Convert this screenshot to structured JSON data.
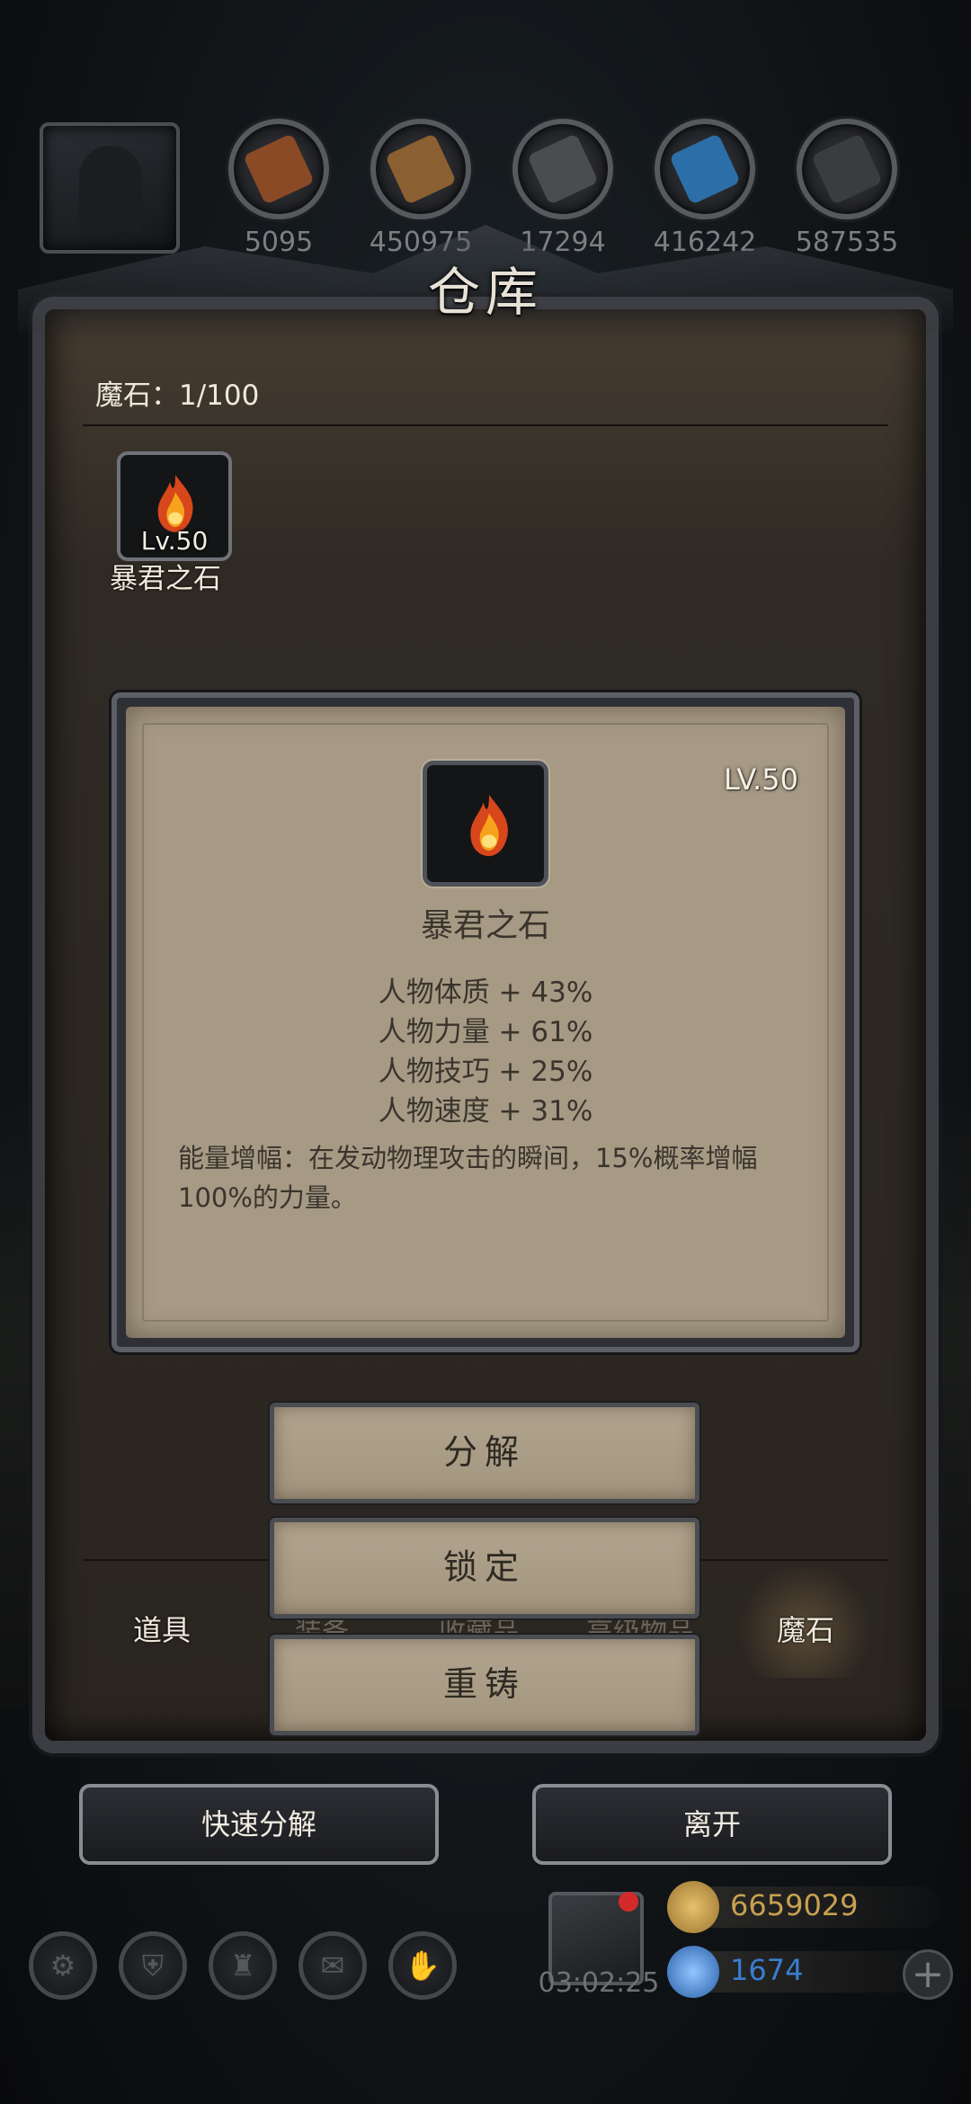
{
  "top_resources": {
    "values": [
      "5095",
      "450975",
      "17294",
      "416242",
      "587535"
    ],
    "colors": [
      "#8a4a26",
      "#8a6032",
      "#4a4c50",
      "#2c6fa8",
      "#3a3c40"
    ]
  },
  "panel": {
    "title": "仓库",
    "count_label": "魔石：1/100"
  },
  "slot": {
    "level": "Lv.50",
    "name": "暴君之石",
    "icon": "fire-stone-icon"
  },
  "detail": {
    "level": "LV.50",
    "name": "暴君之石",
    "stats": [
      "人物体质 + 43%",
      "人物力量 + 61%",
      "人物技巧 + 25%",
      "人物速度 + 31%"
    ],
    "description": "能量增幅：在发动物理攻击的瞬间，15%概率增幅100%的力量。"
  },
  "tabs": {
    "items": [
      "道具",
      "装备",
      "收藏品",
      "高级物品",
      "魔石"
    ],
    "active": "魔石"
  },
  "actions": {
    "decompose": "分解",
    "lock": "锁定",
    "recast": "重铸"
  },
  "bottom": {
    "quick_decompose": "快速分解",
    "leave": "离开"
  },
  "footer": {
    "timer": "03:02:25",
    "gold": "6659029",
    "gems": "1674",
    "gold_color": "#c8a050",
    "gem_color": "#3a7dd0",
    "hud_icons": [
      "gear-icon",
      "shield-icon",
      "castle-icon",
      "mail-icon",
      "handshake-icon"
    ]
  }
}
